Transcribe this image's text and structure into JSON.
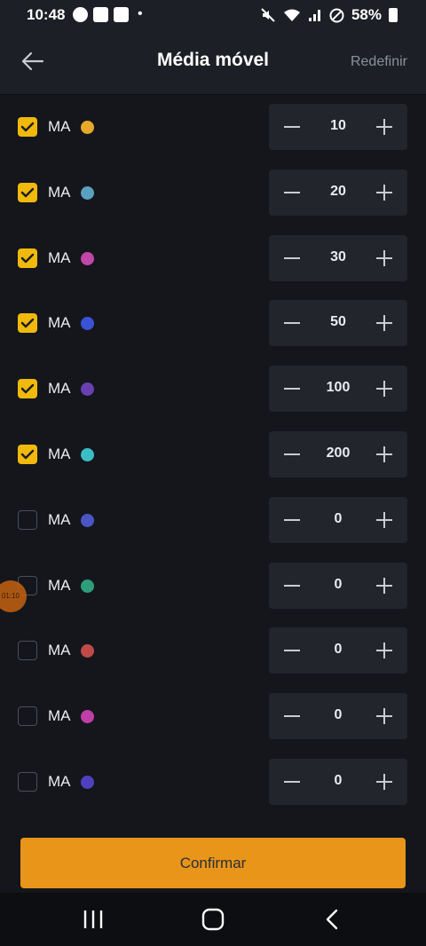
{
  "status": {
    "time": "10:48",
    "dot": "•",
    "battery": "58%"
  },
  "header": {
    "title": "Média móvel",
    "reset_label": "Redefinir"
  },
  "rows": [
    {
      "label": "MA",
      "checked": true,
      "color": "#e7a92b",
      "value": "10"
    },
    {
      "label": "MA",
      "checked": true,
      "color": "#5aa0c0",
      "value": "20"
    },
    {
      "label": "MA",
      "checked": true,
      "color": "#c047a9",
      "value": "30"
    },
    {
      "label": "MA",
      "checked": true,
      "color": "#3a52d6",
      "value": "50"
    },
    {
      "label": "MA",
      "checked": true,
      "color": "#6a3fb0",
      "value": "100"
    },
    {
      "label": "MA",
      "checked": true,
      "color": "#3cbdc6",
      "value": "200"
    },
    {
      "label": "MA",
      "checked": false,
      "color": "#4a55c4",
      "value": "0"
    },
    {
      "label": "MA",
      "checked": false,
      "color": "#2e9e7a",
      "value": "0"
    },
    {
      "label": "MA",
      "checked": false,
      "color": "#c04a4a",
      "value": "0"
    },
    {
      "label": "MA",
      "checked": false,
      "color": "#c03ea8",
      "value": "0"
    },
    {
      "label": "MA",
      "checked": false,
      "color": "#5040c0",
      "value": "0"
    }
  ],
  "touch_indicator": "01:10",
  "confirm_label": "Confirmar",
  "colors": {
    "accent": "#f0b90b",
    "confirm": "#e8951a",
    "background": "#14161b"
  }
}
